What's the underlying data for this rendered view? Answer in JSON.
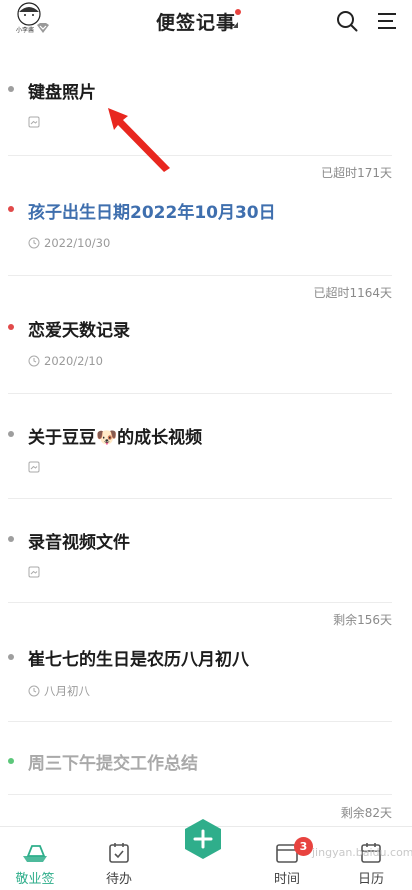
{
  "header": {
    "avatar_name": "小李酱",
    "title": "便签记事"
  },
  "notes": [
    {
      "overdue": "",
      "title": "键盘照片",
      "meta": "",
      "dot_color": "#9e9e9e",
      "title_color": "#1c1c1c",
      "meta_icon": "attachment-icon"
    },
    {
      "overdue": "已超时171天",
      "title": "孩子出生日期2022年10月30日",
      "meta": "2022/10/30",
      "dot_color": "#e14a4a",
      "title_color": "#3f6fae",
      "meta_icon": "clock-icon"
    },
    {
      "overdue": "已超时1164天",
      "title": "恋爱天数记录",
      "meta": "2020/2/10",
      "dot_color": "#e14a4a",
      "title_color": "#1c1c1c",
      "meta_icon": "clock-icon"
    },
    {
      "overdue": "",
      "title": "关于豆豆🐶的成长视频",
      "meta": "",
      "dot_color": "#9e9e9e",
      "title_color": "#1c1c1c",
      "meta_icon": "attachment-icon"
    },
    {
      "overdue": "",
      "title": "录音视频文件",
      "meta": "",
      "dot_color": "#9e9e9e",
      "title_color": "#1c1c1c",
      "meta_icon": "attachment-icon"
    },
    {
      "overdue": "剩余156天",
      "title": "崔七七的生日是农历八月初八",
      "meta": "八月初八",
      "dot_color": "#9e9e9e",
      "title_color": "#1c1c1c",
      "meta_icon": "clock-icon"
    },
    {
      "overdue": "",
      "title": "周三下午提交工作总结",
      "meta": "",
      "dot_color": "#5cc77a",
      "title_color": "#a9a9a9",
      "meta_icon": ""
    },
    {
      "overdue": "剩余82天",
      "title": "",
      "meta": "",
      "dot_color": "",
      "title_color": "",
      "meta_icon": ""
    }
  ],
  "bottom_nav": {
    "items": [
      {
        "label": "敬业签",
        "icon": "ship-icon",
        "active": true
      },
      {
        "label": "待办",
        "icon": "checkbox-icon",
        "active": false
      },
      {
        "label": "",
        "icon": "add-icon",
        "active": false
      },
      {
        "label": "时间",
        "icon": "time-icon",
        "active": false
      },
      {
        "label": "日历",
        "icon": "calendar-icon",
        "active": false
      }
    ],
    "time_badge": "3",
    "watermark": "jingyan.baidu.com"
  },
  "colors": {
    "accent": "#2fae8b",
    "red": "#e14a4a"
  }
}
